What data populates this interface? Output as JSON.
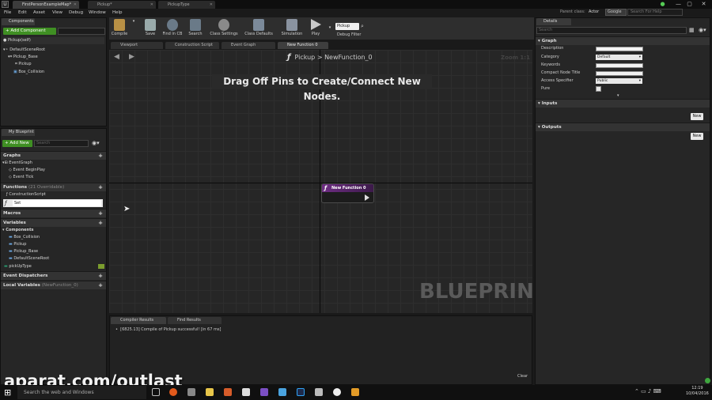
{
  "titlebar": {
    "tabs": [
      "FirstPersonExampleMap*",
      "Pickup*",
      "PickupType"
    ],
    "parent_class_label": "Parent class:",
    "parent_class_value": "Actor",
    "google": "Google",
    "search_help_placeholder": "Search For Help"
  },
  "menu": [
    "File",
    "Edit",
    "Asset",
    "View",
    "Debug",
    "Window",
    "Help"
  ],
  "toolbar": {
    "buttons": [
      "Compile",
      "Save",
      "Find in CB",
      "Search",
      "Class Settings",
      "Class Defaults",
      "Simulation",
      "Play"
    ],
    "debug_object": "Pickup",
    "debug_filter": "Debug Filter"
  },
  "components": {
    "tab": "Components",
    "add_button": "+ Add Component",
    "self_item": "Pickup(self)",
    "tree": [
      "DefaultSceneRoot",
      "Pickup_Base",
      "Pickup",
      "Box_Collision"
    ]
  },
  "my_blueprint": {
    "tab": "My Blueprint",
    "add_new": "+ Add New",
    "search_placeholder": "Search",
    "graphs_header": "Graphs",
    "eventgraph": "EventGraph",
    "events": [
      "Event BeginPlay",
      "Event Tick"
    ],
    "functions_header": "Functions",
    "functions_overridable": "(21 Overridable)",
    "functions": [
      "ConstructionScript"
    ],
    "rename_value": "Set",
    "macros_header": "Macros",
    "variables_header": "Variables",
    "components_header": "Components",
    "component_vars": [
      "Box_Collision",
      "Pickup",
      "Pickup_Base",
      "DefaultSceneRoot"
    ],
    "variable": "pickUpType",
    "dispatchers_header": "Event Dispatchers",
    "local_vars_header": "Local Variables",
    "local_vars_note": "(NewFunction_0)"
  },
  "graph_tabs": [
    "Viewport",
    "Construction Script",
    "Event Graph",
    "New Function 0"
  ],
  "graph": {
    "breadcrumb_root": "Pickup",
    "breadcrumb_sep": ">",
    "breadcrumb_leaf": "NewFunction_0",
    "zoom": "Zoom 1:1",
    "hint": "Drag Off Pins to Create/Connect New Nodes.",
    "watermark": "BLUEPRINT",
    "node_title": "New Function 0"
  },
  "bottom": {
    "tabs": [
      "Compiler Results",
      "Find Results"
    ],
    "log": "[6825.13] Compile of Pickup successful! [in 67 ms]",
    "clear": "Clear"
  },
  "details": {
    "tab": "Details",
    "search_placeholder": "Search",
    "graph_header": "Graph",
    "rows": [
      "Description",
      "Category",
      "Keywords",
      "Compact Node Title",
      "Access Specifier",
      "Pure"
    ],
    "category_value": "Default",
    "access_value": "Public",
    "inputs_header": "Inputs",
    "outputs_header": "Outputs",
    "new_label": "New"
  },
  "taskbar": {
    "search": "Search the web and Windows",
    "time": "12:19",
    "date": "10/04/2016"
  },
  "watermark_text": "aparat.com/outlast",
  "colors": {
    "accent_green": "#3f8f23",
    "node_purple": "#6e2d83"
  }
}
